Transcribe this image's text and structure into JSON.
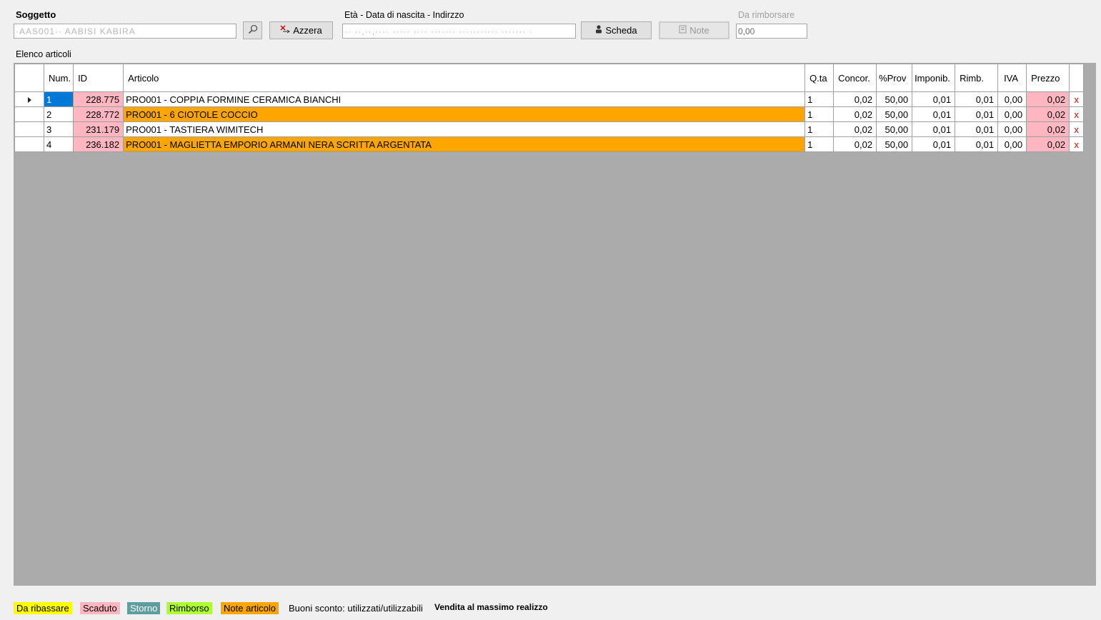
{
  "header": {
    "soggetto_label": "Soggetto",
    "soggetto_value": "·AAS001·· AABISI KABIRA",
    "azzera_label": "Azzera",
    "eta_label": "Età - Data di nascita - Indirzzo",
    "eta_value": "··  ··,··,····  ·····  ···· ·······  ···········  ······· ·",
    "scheda_label": "Scheda",
    "note_label": "Note",
    "rimborsare_label": "Da rimborsare",
    "rimborsare_value": "0,00"
  },
  "list": {
    "title": "Elenco articoli",
    "columns": [
      "Num.",
      "ID",
      "Articolo",
      "Q.ta",
      "Concor.",
      "%Prov",
      "Imponib.",
      "Rimb.",
      "IVA",
      "Prezzo"
    ],
    "rows": [
      {
        "num": "1",
        "id": "228.775",
        "articolo": "PRO001 - COPPIA FORMINE CERAMICA BIANCHI",
        "qta": "1",
        "concor": "0,02",
        "prov": "50,00",
        "imponib": "0,01",
        "rimb": "0,01",
        "iva": "0,00",
        "prezzo": "0,02",
        "del": "x"
      },
      {
        "num": "2",
        "id": "228.772",
        "articolo": "PRO001 - 6 CIOTOLE COCCIO",
        "qta": "1",
        "concor": "0,02",
        "prov": "50,00",
        "imponib": "0,01",
        "rimb": "0,01",
        "iva": "0,00",
        "prezzo": "0,02",
        "del": "x"
      },
      {
        "num": "3",
        "id": "231.179",
        "articolo": "PRO001 - TASTIERA WIMITECH",
        "qta": "1",
        "concor": "0,02",
        "prov": "50,00",
        "imponib": "0,01",
        "rimb": "0,01",
        "iva": "0,00",
        "prezzo": "0,02",
        "del": "x"
      },
      {
        "num": "4",
        "id": "236.182",
        "articolo": "PRO001 - MAGLIETTA EMPORIO ARMANI NERA SCRITTA ARGENTATA",
        "qta": "1",
        "concor": "0,02",
        "prov": "50,00",
        "imponib": "0,01",
        "rimb": "0,01",
        "iva": "0,00",
        "prezzo": "0,02",
        "del": "x"
      }
    ]
  },
  "legend": {
    "da_ribassare": "Da ribassare",
    "scaduto": "Scaduto",
    "storno": "Storno",
    "rimborso": "Rimborso",
    "note_articolo": "Note articolo",
    "buoni": "Buoni sconto: utilizzati/utilizzabili",
    "vendita": "Vendita al massimo realizzo"
  },
  "colors": {
    "yellow": "#ffff00",
    "pink": "#ffb6c1",
    "teal": "#5f9ea0",
    "green": "#adff2f",
    "orange": "#ffa500",
    "selected": "#0078d7",
    "grid_bg": "#ababab"
  }
}
